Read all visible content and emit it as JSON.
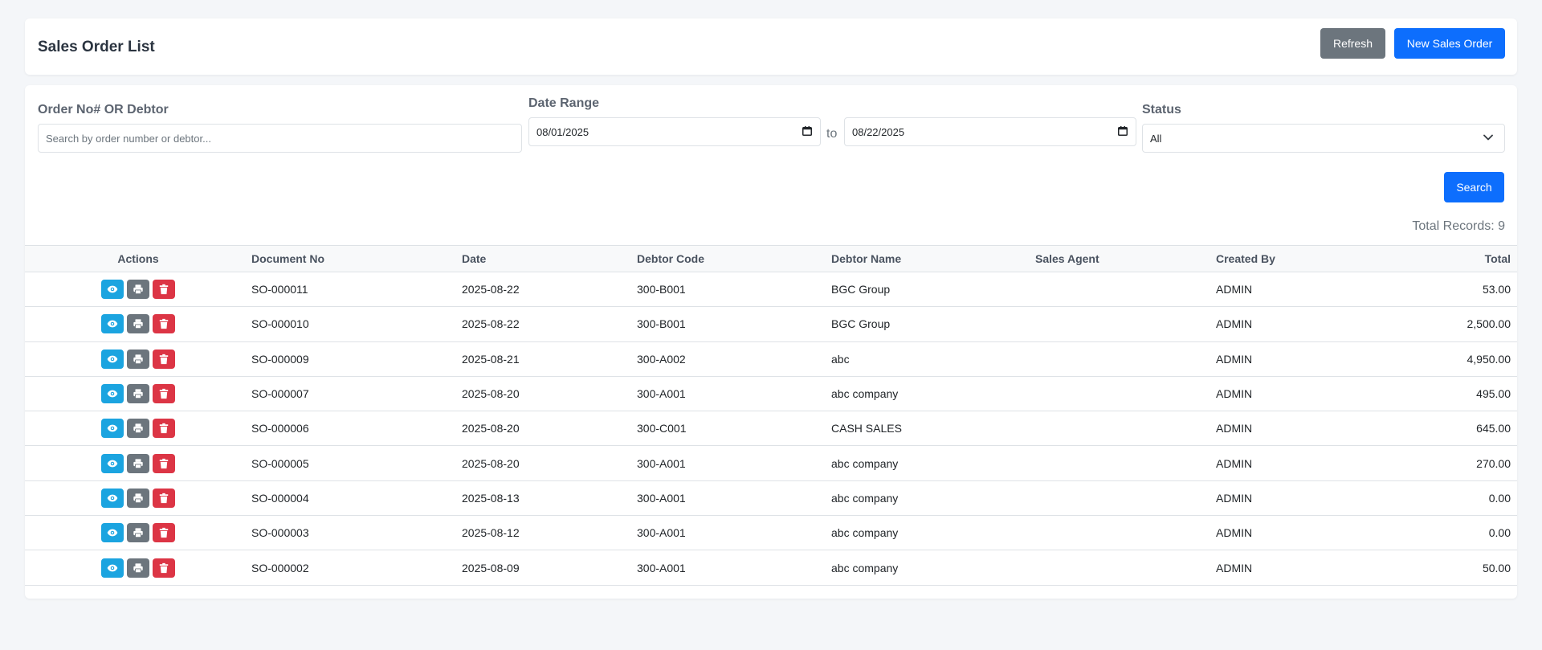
{
  "header": {
    "title": "Sales Order List",
    "refresh_label": "Refresh",
    "new_label": "New Sales Order"
  },
  "filters": {
    "order_label": "Order No# OR Debtor",
    "order_placeholder": "Search by order number or debtor...",
    "date_label": "Date Range",
    "date_from": "08/01/2025",
    "to_label": "to",
    "date_to": "08/22/2025",
    "status_label": "Status",
    "status_value": "All",
    "search_label": "Search"
  },
  "total_records": "Total Records: 9",
  "table": {
    "columns": [
      "Actions",
      "Document No",
      "Date",
      "Debtor Code",
      "Debtor Name",
      "Sales Agent",
      "Created By",
      "Total"
    ],
    "rows": [
      {
        "doc": "SO-000011",
        "date": "2025-08-22",
        "code": "300-B001",
        "name": "BGC Group",
        "agent": "",
        "created": "ADMIN",
        "total": "53.00"
      },
      {
        "doc": "SO-000010",
        "date": "2025-08-22",
        "code": "300-B001",
        "name": "BGC Group",
        "agent": "",
        "created": "ADMIN",
        "total": "2,500.00"
      },
      {
        "doc": "SO-000009",
        "date": "2025-08-21",
        "code": "300-A002",
        "name": "abc",
        "agent": "",
        "created": "ADMIN",
        "total": "4,950.00"
      },
      {
        "doc": "SO-000007",
        "date": "2025-08-20",
        "code": "300-A001",
        "name": "abc company",
        "agent": "",
        "created": "ADMIN",
        "total": "495.00"
      },
      {
        "doc": "SO-000006",
        "date": "2025-08-20",
        "code": "300-C001",
        "name": "CASH SALES",
        "agent": "",
        "created": "ADMIN",
        "total": "645.00"
      },
      {
        "doc": "SO-000005",
        "date": "2025-08-20",
        "code": "300-A001",
        "name": "abc company",
        "agent": "",
        "created": "ADMIN",
        "total": "270.00"
      },
      {
        "doc": "SO-000004",
        "date": "2025-08-13",
        "code": "300-A001",
        "name": "abc company",
        "agent": "",
        "created": "ADMIN",
        "total": "0.00"
      },
      {
        "doc": "SO-000003",
        "date": "2025-08-12",
        "code": "300-A001",
        "name": "abc company",
        "agent": "",
        "created": "ADMIN",
        "total": "0.00"
      },
      {
        "doc": "SO-000002",
        "date": "2025-08-09",
        "code": "300-A001",
        "name": "abc company",
        "agent": "",
        "created": "ADMIN",
        "total": "50.00"
      }
    ]
  },
  "icons": {
    "view": "eye-icon",
    "print": "printer-icon",
    "delete": "trash-icon",
    "calendar": "calendar-icon",
    "dropdown": "chevron-down-icon"
  },
  "colors": {
    "primary": "#0d6efd",
    "secondary": "#6c757d",
    "info": "#1ba4e0",
    "danger": "#dc3545"
  }
}
